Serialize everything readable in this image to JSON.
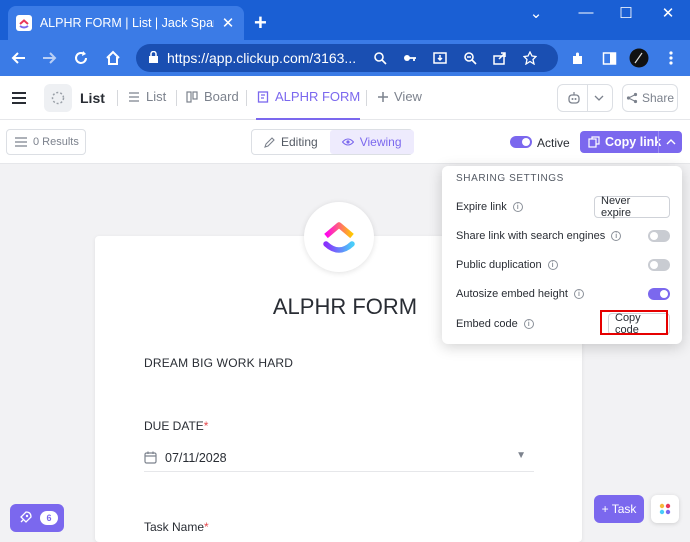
{
  "browser": {
    "tab_title": "ALPHR FORM | List | Jack Sparrow",
    "close_glyph": "✕",
    "newtab_glyph": "+",
    "url": "https://app.clickup.com/3163...",
    "window_controls": [
      "⌄",
      "—",
      "☐",
      "✕"
    ]
  },
  "header": {
    "list_title": "List",
    "views": [
      {
        "label": "List",
        "icon": "list-icon"
      },
      {
        "label": "Board",
        "icon": "board-icon"
      },
      {
        "label": "ALPHR FORM",
        "icon": "form-icon",
        "active": true
      },
      {
        "label": "View",
        "icon": "plus-icon"
      }
    ],
    "share_label": "Share"
  },
  "toolbar": {
    "results_label": "0 Results",
    "modes": [
      {
        "label": "Editing",
        "active": false
      },
      {
        "label": "Viewing",
        "active": true
      }
    ],
    "active_label": "Active",
    "active_on": true,
    "copy_link_label": "Copy link"
  },
  "form": {
    "title": "ALPHR FORM",
    "description": "DREAM BIG WORK HARD",
    "fields": [
      {
        "label": "DUE DATE",
        "required": true,
        "value": "07/11/2028"
      },
      {
        "label": "Task Name",
        "required": true
      }
    ],
    "required_mark": "*"
  },
  "sharing": {
    "title": "SHARING SETTINGS",
    "rows": [
      {
        "label": "Expire link",
        "control": "button",
        "value": "Never expire"
      },
      {
        "label": "Share link with search engines",
        "control": "toggle",
        "on": false
      },
      {
        "label": "Public duplication",
        "control": "toggle",
        "on": false
      },
      {
        "label": "Autosize embed height",
        "control": "toggle",
        "on": true
      },
      {
        "label": "Embed code",
        "control": "button",
        "value": "Copy code"
      }
    ]
  },
  "floating": {
    "badge_count": "6",
    "task_label": "+ Task"
  },
  "colors": {
    "accent": "#7b68ee",
    "chrome_tabstrip": "#1a5fd4",
    "chrome_toolbar": "#3b7be6",
    "highlight": "#e60000"
  }
}
